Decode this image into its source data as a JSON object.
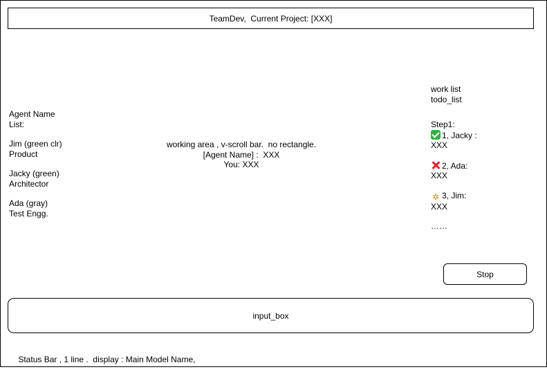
{
  "title_bar": {
    "text": "TeamDev,  Current Project: [XXX]"
  },
  "agent_list": {
    "heading_line1": "Agent Name",
    "heading_line2": "List:",
    "agents": [
      {
        "name": "Jim (green clr)",
        "role": "Product"
      },
      {
        "name": "Jacky (green)",
        "role": "Architector"
      },
      {
        "name": "Ada (gray)",
        "role": "Test Engg."
      }
    ]
  },
  "work_area": {
    "description": "working area , v-scroll bar.  no rectangle.",
    "agent_line": "[Agent Name] :  XXX",
    "user_line": "You: XXX"
  },
  "side_panel": {
    "work_list_label": "work list",
    "todo_list_label": "todo_list",
    "step_heading": "Step1:",
    "steps": [
      {
        "icon": "check-mark-icon",
        "title": "1, Jacky :",
        "value": "XXX"
      },
      {
        "icon": "cross-mark-icon",
        "title": "2, Ada:",
        "value": "XXX"
      },
      {
        "icon": "running-person-icon",
        "title": "3, Jim:",
        "value": "XXX"
      }
    ],
    "more": "……"
  },
  "stop_button": {
    "label": "Stop"
  },
  "input_box": {
    "placeholder": "input_box"
  },
  "status_bar": {
    "text": "Status Bar , 1 line .  display : Main Model Name,"
  },
  "colors": {
    "success": "#2fb344",
    "failure": "#e0232e",
    "running": "#c98a1d",
    "border": "#000000",
    "background": "#ffffff"
  }
}
